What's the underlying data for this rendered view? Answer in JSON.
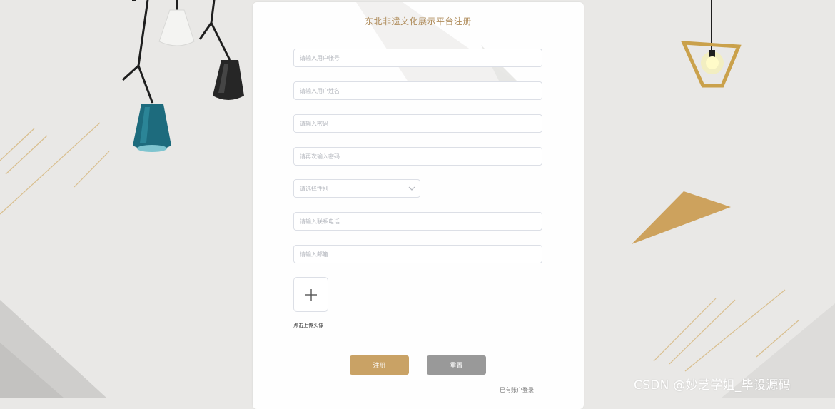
{
  "form": {
    "title": "东北非遗文化展示平台注册",
    "account_placeholder": "请输入用户帐号",
    "name_placeholder": "请输入用户姓名",
    "password_placeholder": "请输入密码",
    "confirm_password_placeholder": "请再次输入密码",
    "gender_placeholder": "请选择性别",
    "phone_placeholder": "请输入联系电话",
    "email_placeholder": "请输入邮箱",
    "upload_label": "点击上传头像",
    "register_label": "注册",
    "reset_label": "重置",
    "login_link": "已有账户登录"
  },
  "icons": {
    "gender_dropdown": "chevron-down-icon",
    "upload": "plus-icon"
  },
  "colors": {
    "accent": "#c9a265",
    "title": "#b08d5c",
    "reset_button": "#999999",
    "background": "#e9e8e6"
  },
  "watermark": "CSDN @妙芝学姐_毕设源码"
}
